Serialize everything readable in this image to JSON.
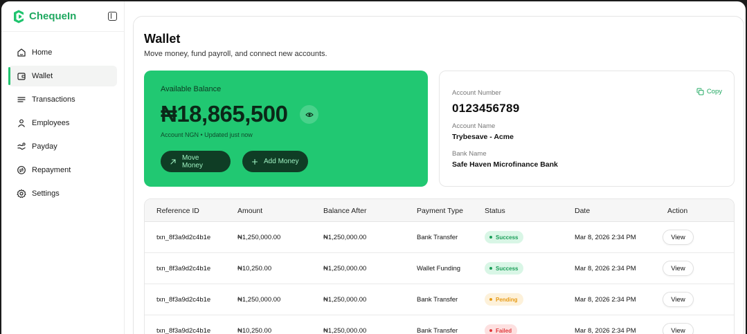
{
  "brand": {
    "name": "ChequeIn",
    "accent": "#1fa860"
  },
  "sidebar": {
    "items": [
      {
        "label": "Home",
        "icon": "home-icon",
        "active": false
      },
      {
        "label": "Wallet",
        "icon": "wallet-icon",
        "active": true
      },
      {
        "label": "Transactions",
        "icon": "list-icon",
        "active": false
      },
      {
        "label": "Employees",
        "icon": "user-icon",
        "active": false
      },
      {
        "label": "Payday",
        "icon": "money-icon",
        "active": false
      },
      {
        "label": "Repayment",
        "icon": "repayment-icon",
        "active": false
      },
      {
        "label": "Settings",
        "icon": "gear-icon",
        "active": false
      }
    ]
  },
  "page": {
    "title": "Wallet",
    "subtitle": "Move money, fund payroll, and connect new accounts."
  },
  "balance": {
    "label": "Available Balance",
    "amount": "₦18,865,500",
    "meta": "Account NGN • Updated just now",
    "move_label": "Move Money",
    "add_label": "Add Money",
    "card_color": "#21c872"
  },
  "account": {
    "number_label": "Account Number",
    "number": "0123456789",
    "copy_label": "Copy",
    "name_label": "Account Name",
    "name": "Trybesave - Acme",
    "bank_label": "Bank Name",
    "bank": "Safe Haven Microfinance Bank"
  },
  "table": {
    "headers": [
      "Reference ID",
      "Amount",
      "Balance After",
      "Payment Type",
      "Status",
      "Date",
      "Action"
    ],
    "rows": [
      {
        "ref": "txn_8f3a9d2c4b1e",
        "amount": "₦1,250,000.00",
        "balance_after": "₦1,250,000.00",
        "type": "Bank Transfer",
        "status": "Success",
        "status_kind": "success",
        "date": "Mar 8, 2026 2:34 PM",
        "action": "View"
      },
      {
        "ref": "txn_8f3a9d2c4b1e",
        "amount": "₦10,250.00",
        "balance_after": "₦1,250,000.00",
        "type": "Wallet Funding",
        "status": "Success",
        "status_kind": "success",
        "date": "Mar 8, 2026 2:34 PM",
        "action": "View"
      },
      {
        "ref": "txn_8f3a9d2c4b1e",
        "amount": "₦1,250,000.00",
        "balance_after": "₦1,250,000.00",
        "type": "Bank Transfer",
        "status": "Pending",
        "status_kind": "pending",
        "date": "Mar 8, 2026 2:34 PM",
        "action": "View"
      },
      {
        "ref": "txn_8f3a9d2c4b1e",
        "amount": "₦10,250.00",
        "balance_after": "₦1,250,000.00",
        "type": "Bank Transfer",
        "status": "Failed",
        "status_kind": "failed",
        "date": "Mar 8, 2026 2:34 PM",
        "action": "View"
      }
    ]
  }
}
